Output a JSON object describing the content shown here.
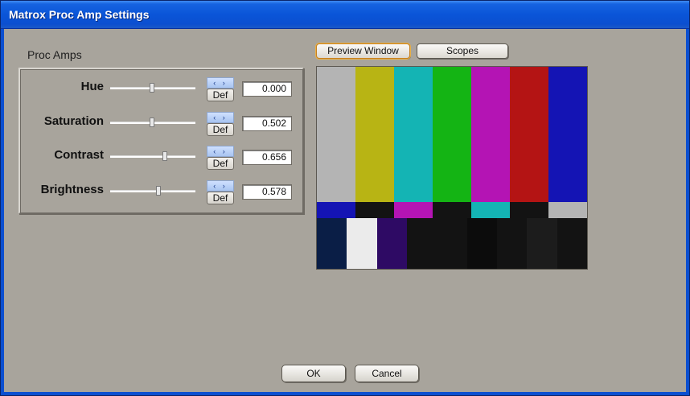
{
  "window": {
    "title": "Matrox Proc Amp Settings"
  },
  "group": {
    "label": "Proc Amps"
  },
  "controls": [
    {
      "label": "Hue",
      "value": "0.000",
      "slider_fraction": 0.5,
      "spin_glyph": "‹ ›",
      "def_label": "Def"
    },
    {
      "label": "Saturation",
      "value": "0.502",
      "slider_fraction": 0.5,
      "spin_glyph": "‹ ›",
      "def_label": "Def"
    },
    {
      "label": "Contrast",
      "value": "0.656",
      "slider_fraction": 0.66,
      "spin_glyph": "‹ ›",
      "def_label": "Def"
    },
    {
      "label": "Brightness",
      "value": "0.578",
      "slider_fraction": 0.58,
      "spin_glyph": "‹ ›",
      "def_label": "Def"
    }
  ],
  "tabs": {
    "preview": "Preview Window",
    "scopes": "Scopes"
  },
  "preview": {
    "top_bars": [
      "#b4b4b4",
      "#b8b414",
      "#14b4b4",
      "#14b414",
      "#b414b4",
      "#b41414",
      "#1414b4"
    ],
    "middle_bars": [
      "#1414b4",
      "#131313",
      "#b414b4",
      "#131313",
      "#14b4b4",
      "#131313",
      "#b4b4b4"
    ],
    "bottom_bars": [
      "#0a1e46",
      "#ebebeb",
      "#2e0a64",
      "#131313",
      "#131313",
      "#0c0c0c",
      "#131313",
      "#1c1c1c",
      "#131313"
    ]
  },
  "buttons": {
    "ok": "OK",
    "cancel": "Cancel"
  },
  "colors": {
    "titlebar": "#0b4fd0",
    "dialog_bg": "#a8a49c"
  }
}
